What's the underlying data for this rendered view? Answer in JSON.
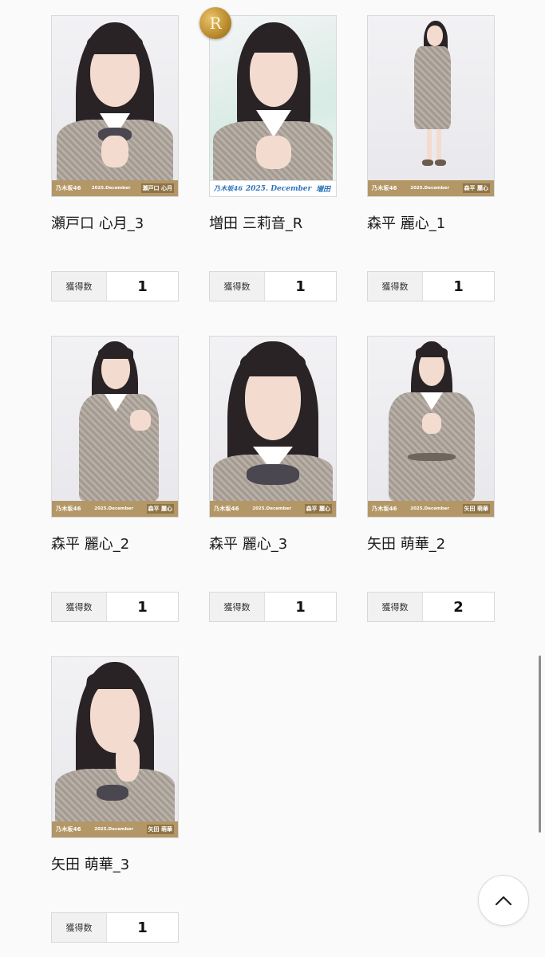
{
  "count_label": "獲得数",
  "cards": [
    {
      "name": "瀬戸口 心月_3",
      "count": "1",
      "rare": false,
      "badge": "",
      "bar": {
        "logo": "乃木坂46",
        "date": "2025.December",
        "member": "瀬戸口 心月"
      }
    },
    {
      "name": "増田 三莉音_R",
      "count": "1",
      "rare": true,
      "badge": "R",
      "bar": {
        "logo": "乃木坂46",
        "date": "2025. December",
        "member": "増田"
      }
    },
    {
      "name": "森平 麗心_1",
      "count": "1",
      "rare": false,
      "badge": "",
      "bar": {
        "logo": "乃木坂46",
        "date": "2025.December",
        "member": "森平 麗心"
      }
    },
    {
      "name": "森平 麗心_2",
      "count": "1",
      "rare": false,
      "badge": "",
      "bar": {
        "logo": "乃木坂46",
        "date": "2025.December",
        "member": "森平 麗心"
      }
    },
    {
      "name": "森平 麗心_3",
      "count": "1",
      "rare": false,
      "badge": "",
      "bar": {
        "logo": "乃木坂46",
        "date": "2025.December",
        "member": "森平 麗心"
      }
    },
    {
      "name": "矢田 萌華_2",
      "count": "2",
      "rare": false,
      "badge": "",
      "bar": {
        "logo": "乃木坂46",
        "date": "2025.December",
        "member": "矢田 萌華"
      }
    },
    {
      "name": "矢田 萌華_3",
      "count": "1",
      "rare": false,
      "badge": "",
      "bar": {
        "logo": "乃木坂46",
        "date": "2025.December",
        "member": "矢田 萌華"
      }
    }
  ],
  "back_to_top": {
    "icon": "chevron-up-icon"
  },
  "colors": {
    "card_bar": "#b39767",
    "rare_badge": "#c49a3d",
    "signature": "#2f73b8"
  }
}
